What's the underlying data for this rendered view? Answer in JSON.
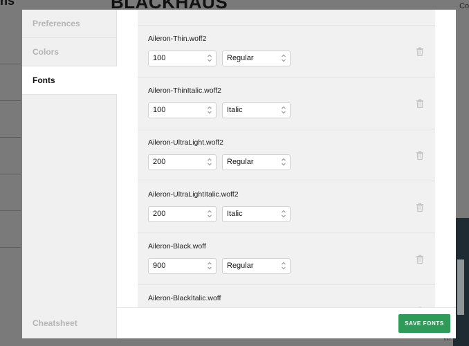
{
  "background": {
    "top_left_text": "ns",
    "title": "BLACKHAUS",
    "right_text": "Co",
    "bottom_text": "Th"
  },
  "sidebar": {
    "items": [
      {
        "label": "Preferences",
        "active": false
      },
      {
        "label": "Colors",
        "active": false
      },
      {
        "label": "Fonts",
        "active": true
      }
    ],
    "bottom_label": "Cheatsheet"
  },
  "fonts": [
    {
      "name": "Aileron-Thin.woff2",
      "weight": "100",
      "style": "Regular"
    },
    {
      "name": "Aileron-ThinItalic.woff2",
      "weight": "100",
      "style": "Italic"
    },
    {
      "name": "Aileron-UltraLight.woff2",
      "weight": "200",
      "style": "Regular"
    },
    {
      "name": "Aileron-UltraLightItalic.woff2",
      "weight": "200",
      "style": "Italic"
    },
    {
      "name": "Aileron-Black.woff",
      "weight": "900",
      "style": "Regular"
    },
    {
      "name": "Aileron-BlackItalic.woff",
      "weight": "",
      "style": ""
    }
  ],
  "footer": {
    "save_label": "SAVE FONTS",
    "accent_color": "#2f9b59"
  },
  "icons": {
    "trash": "trash-icon",
    "select_chevron": "select-chevron-icon"
  }
}
